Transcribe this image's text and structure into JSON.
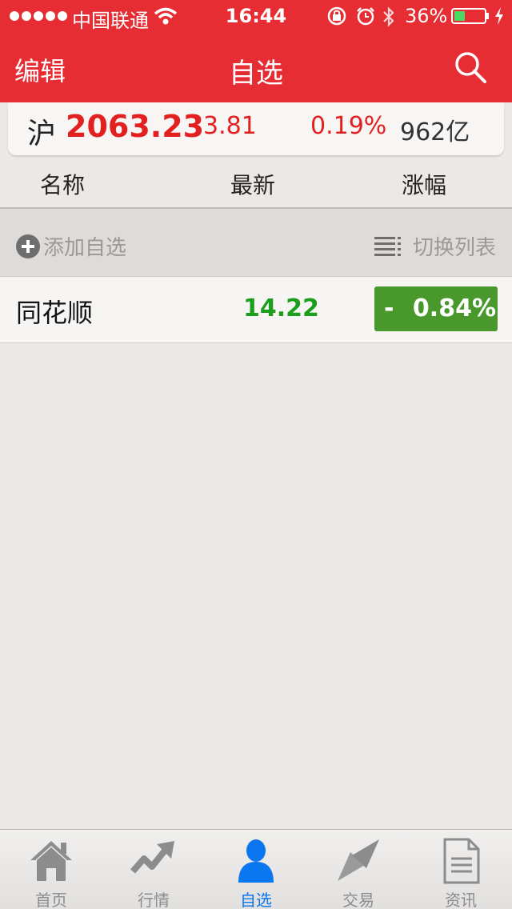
{
  "status_bar": {
    "carrier": "中国联通",
    "time": "16:44",
    "battery": "36%",
    "battery_level": 0.36
  },
  "nav": {
    "edit_label": "编辑",
    "title": "自选"
  },
  "index": {
    "market": "沪",
    "value": "2063.23",
    "change": "3.81",
    "change_pct": "0.19%",
    "volume": "962亿"
  },
  "columns": [
    "名称",
    "最新",
    "涨幅"
  ],
  "toolbar": {
    "add_label": "添加自选",
    "switch_label": "切换列表"
  },
  "stocks": [
    {
      "name": "同花顺",
      "price": "14.22",
      "sign": "-",
      "change_pct": "0.84%"
    }
  ],
  "tabs": [
    {
      "label": "首页",
      "icon": "home-icon"
    },
    {
      "label": "行情",
      "icon": "trend-icon"
    },
    {
      "label": "自选",
      "icon": "person-icon",
      "active": true
    },
    {
      "label": "交易",
      "icon": "exchange-icon"
    },
    {
      "label": "资讯",
      "icon": "document-icon"
    }
  ],
  "colors": {
    "header": "#e52d33",
    "rise": "#e2201f",
    "fall": "#1b9e1b",
    "fall_badge": "#48982b",
    "active_tab": "#0a76f0"
  }
}
